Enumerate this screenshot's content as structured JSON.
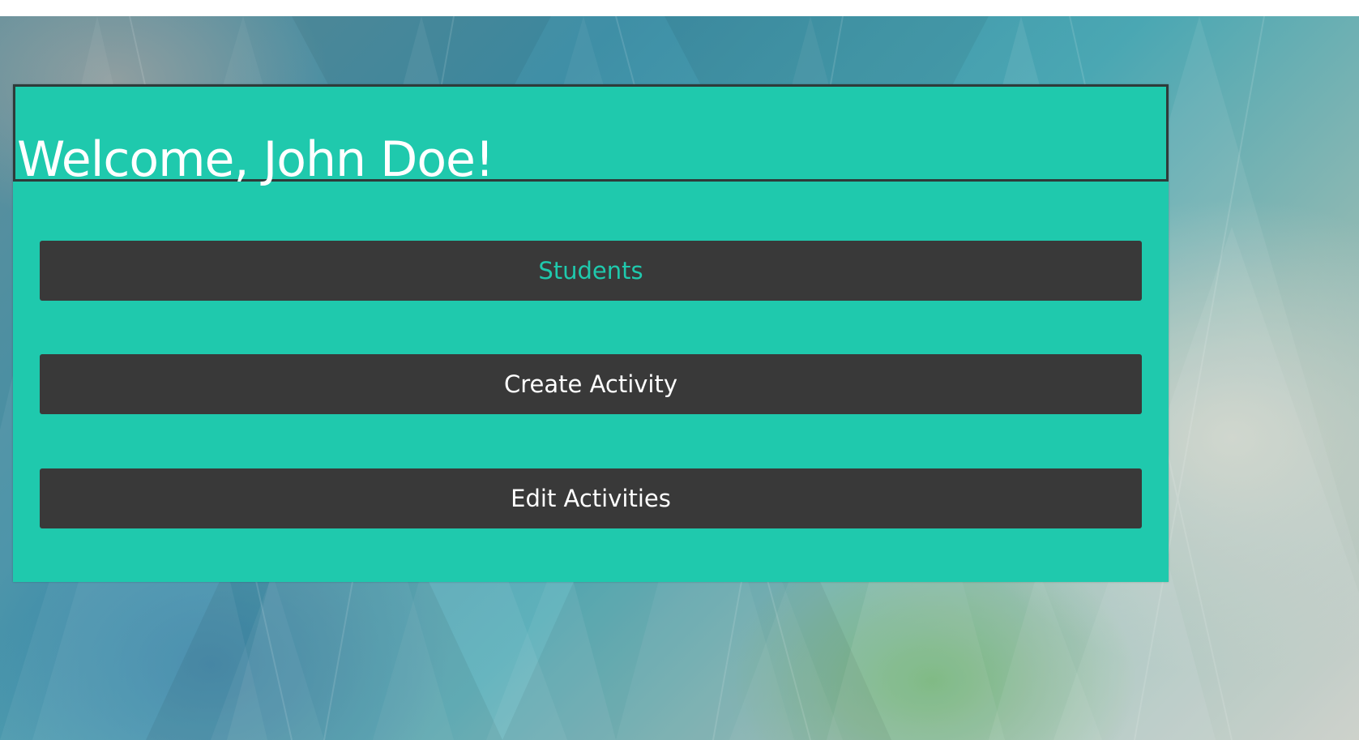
{
  "page": {
    "welcome_text": "Welcome, John Doe!"
  },
  "menu": {
    "buttons": [
      {
        "label": "Students",
        "active": true
      },
      {
        "label": "Create Activity",
        "active": false
      },
      {
        "label": "Edit Activities",
        "active": false
      }
    ]
  },
  "colors": {
    "panel": "#1fc9ad",
    "button": "#393939",
    "active_text": "#1fc9ad",
    "text": "#ffffff"
  }
}
